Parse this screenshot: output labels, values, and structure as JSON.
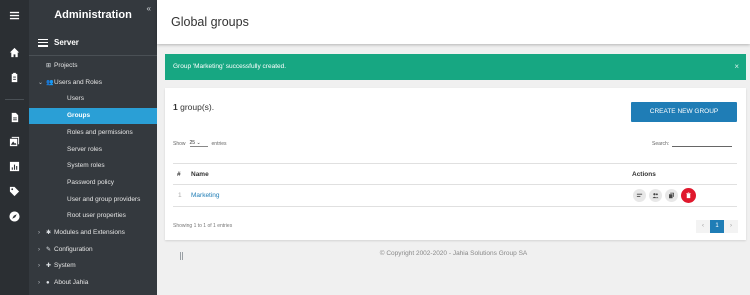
{
  "sidebar": {
    "title": "Administration",
    "collapse_glyph": "«",
    "section": "Server",
    "items": [
      {
        "label": "Projects",
        "glyph": "⊞",
        "arrow": "",
        "indent": 17
      },
      {
        "label": "Users and Roles",
        "glyph": "👥",
        "arrow": "⌄",
        "indent": 9
      },
      {
        "label": "Users",
        "glyph": "",
        "arrow": "",
        "indent": 38
      },
      {
        "label": "Groups",
        "glyph": "",
        "arrow": "",
        "indent": 38,
        "active": true
      },
      {
        "label": "Roles and permissions",
        "glyph": "",
        "arrow": "",
        "indent": 38
      },
      {
        "label": "Server roles",
        "glyph": "",
        "arrow": "",
        "indent": 38
      },
      {
        "label": "System roles",
        "glyph": "",
        "arrow": "",
        "indent": 38
      },
      {
        "label": "Password policy",
        "glyph": "",
        "arrow": "",
        "indent": 38
      },
      {
        "label": "User and group providers",
        "glyph": "",
        "arrow": "",
        "indent": 38
      },
      {
        "label": "Root user properties",
        "glyph": "",
        "arrow": "",
        "indent": 38
      },
      {
        "label": "Modules and Extensions",
        "glyph": "✱",
        "arrow": "›",
        "indent": 9
      },
      {
        "label": "Configuration",
        "glyph": "✎",
        "arrow": "›",
        "indent": 9
      },
      {
        "label": "System",
        "glyph": "✚",
        "arrow": "›",
        "indent": 9
      },
      {
        "label": "About Jahia",
        "glyph": "●",
        "arrow": "›",
        "indent": 9
      }
    ]
  },
  "rail_icons": [
    "menu-icon",
    "home-icon",
    "clipboard-icon",
    "document-icon",
    "gallery-icon",
    "chart-icon",
    "tag-icon",
    "compass-icon"
  ],
  "header": {
    "title": "Global groups"
  },
  "alert": {
    "message": "Group 'Marketing' successfully created.",
    "close": "×"
  },
  "card": {
    "count": "1",
    "count_suffix": " group(s).",
    "create_label": "CREATE NEW GROUP",
    "show_prefix": "Show",
    "show_value": "25",
    "show_suffix": "entries",
    "search_label": "Search:",
    "columns": [
      "#",
      "Name",
      "Actions"
    ],
    "rows": [
      {
        "num": "1",
        "name": "Marketing"
      }
    ],
    "info": "Showing 1 to 1 of 1 entries",
    "pager": {
      "prev": "‹",
      "page": "1",
      "next": "›"
    }
  },
  "footer": "© Copyright 2002-2020 - Jahia Solutions Group SA",
  "colors": {
    "accent": "#2a9fd6",
    "primary": "#1f7db6",
    "success": "#17a782",
    "danger": "#e0182d",
    "sidebar": "#34393e"
  }
}
